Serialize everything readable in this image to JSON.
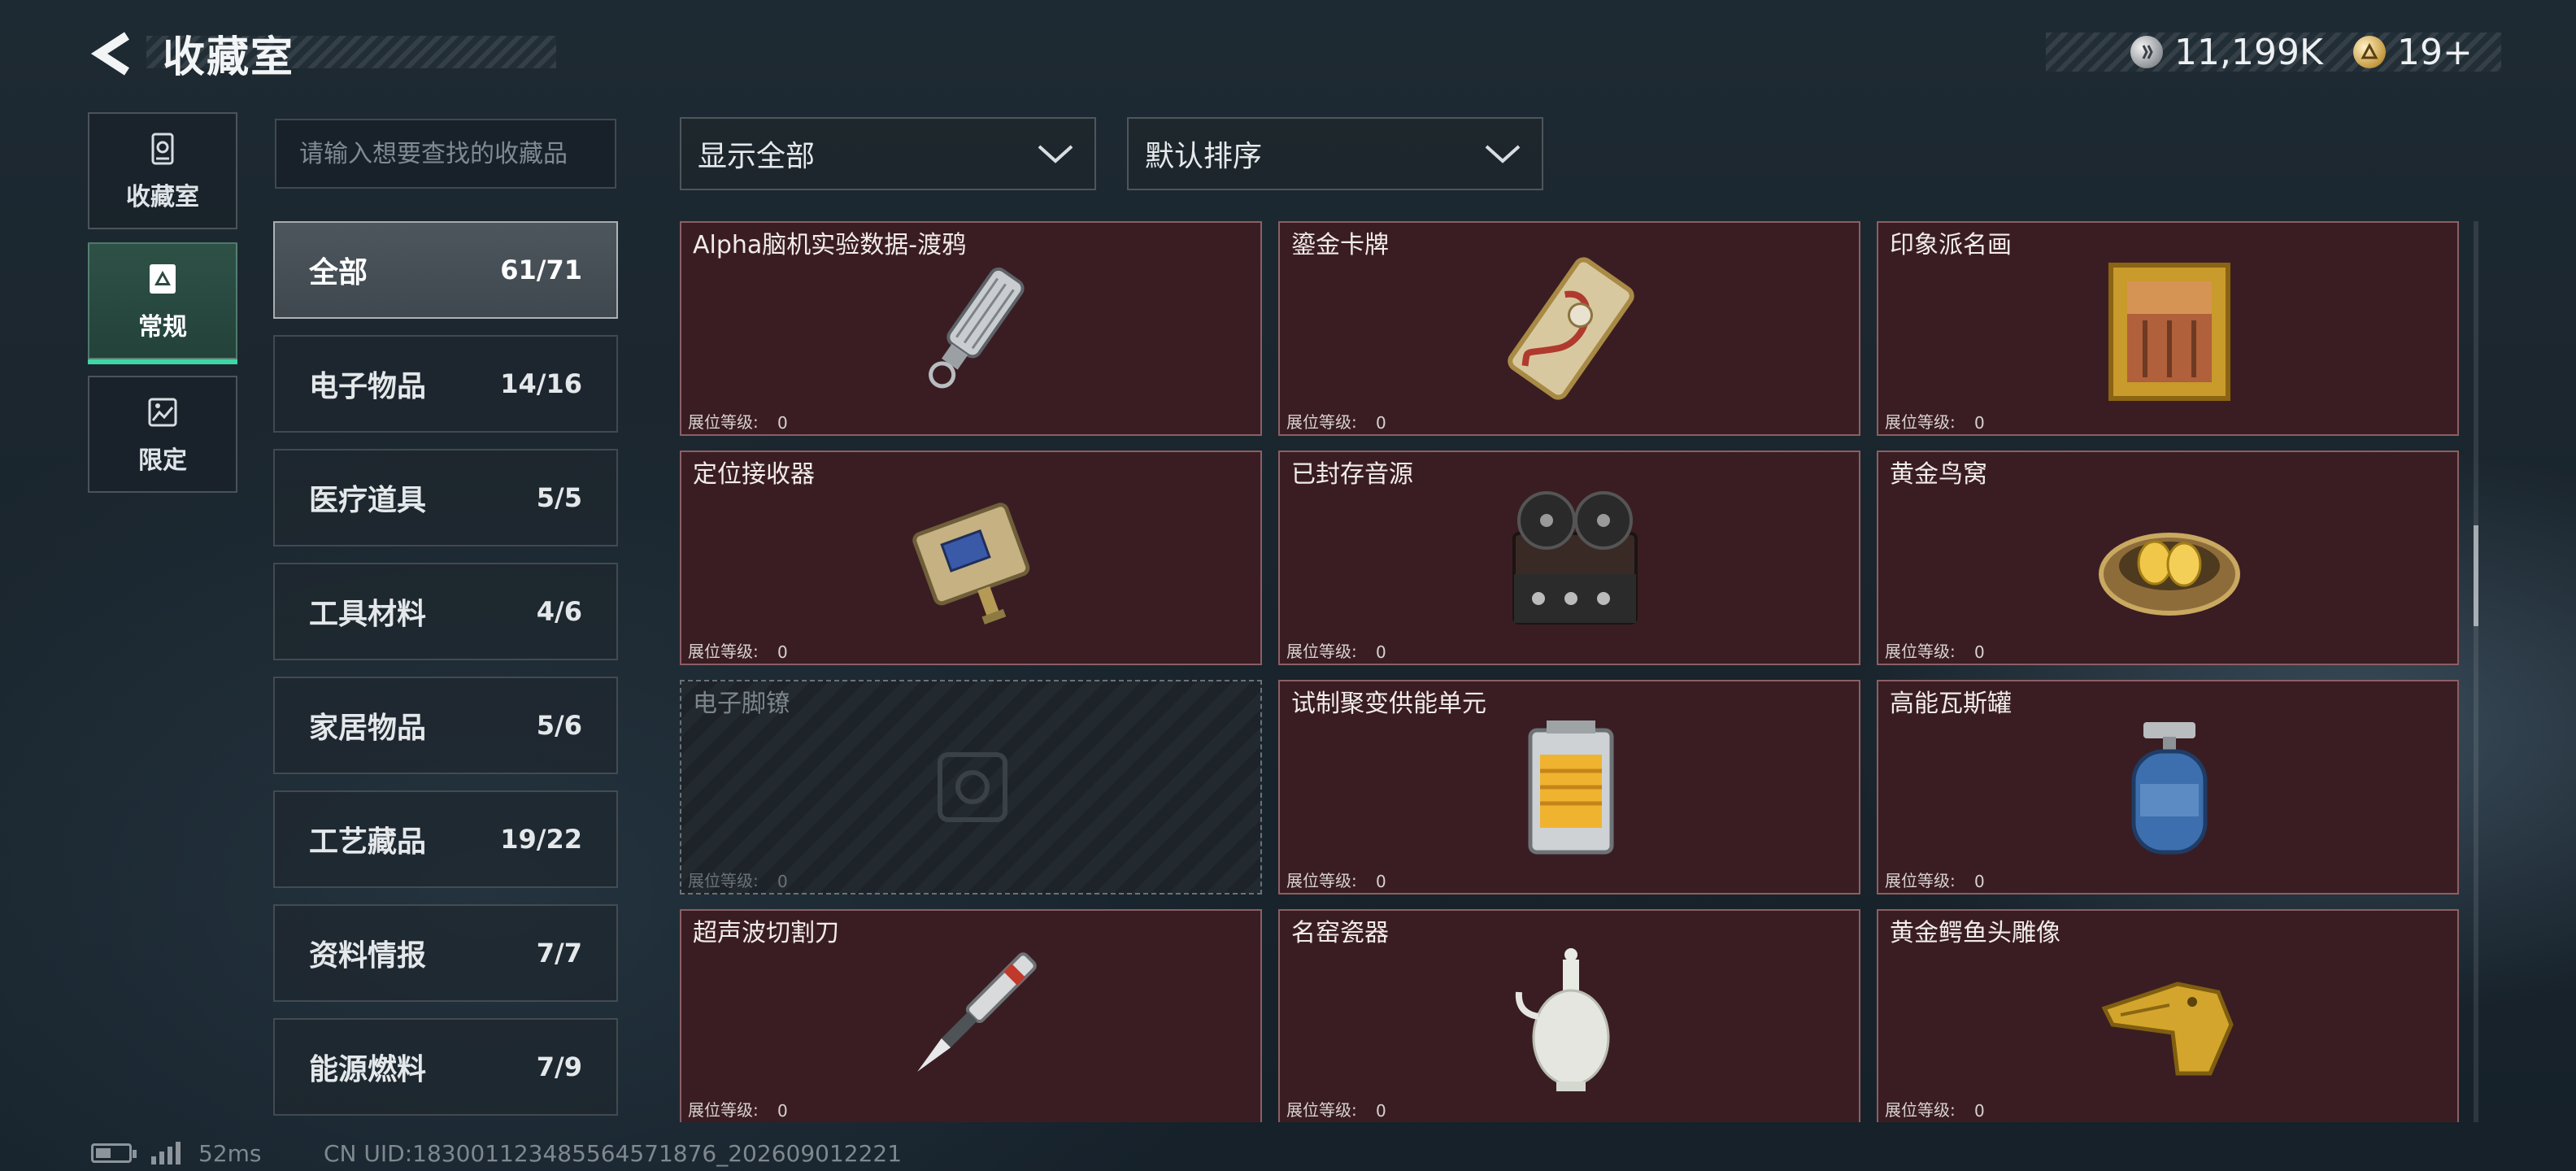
{
  "header": {
    "title": "收藏室",
    "currencies": [
      {
        "icon": "silver-coin-icon",
        "value": "11,199K"
      },
      {
        "icon": "gold-coin-icon",
        "value": "19+"
      }
    ]
  },
  "side_tabs": [
    {
      "label": "收藏室",
      "icon": "collection-room-icon",
      "active": false
    },
    {
      "label": "常规",
      "icon": "regular-icon",
      "active": true
    },
    {
      "label": "限定",
      "icon": "limited-icon",
      "active": false
    }
  ],
  "search": {
    "placeholder": "请输入想要查找的收藏品"
  },
  "categories": [
    {
      "name": "全部",
      "count": "61/71",
      "active": true
    },
    {
      "name": "电子物品",
      "count": "14/16"
    },
    {
      "name": "医疗道具",
      "count": "5/5"
    },
    {
      "name": "工具材料",
      "count": "4/6"
    },
    {
      "name": "家居物品",
      "count": "5/6"
    },
    {
      "name": "工艺藏品",
      "count": "19/22"
    },
    {
      "name": "资料情报",
      "count": "7/7"
    },
    {
      "name": "能源燃料",
      "count": "7/9"
    }
  ],
  "filters": {
    "display": "显示全部",
    "sort": "默认排序"
  },
  "level_label": "展位等级:",
  "items": [
    {
      "name": "Alpha脑机实验数据-渡鸦",
      "level": "0",
      "icon": "usb-drive-icon",
      "locked": false
    },
    {
      "name": "鎏金卡牌",
      "level": "0",
      "icon": "gilded-card-icon",
      "locked": false
    },
    {
      "name": "印象派名画",
      "level": "0",
      "icon": "framed-painting-icon",
      "locked": false
    },
    {
      "name": "定位接收器",
      "level": "0",
      "icon": "gps-receiver-icon",
      "locked": false
    },
    {
      "name": "已封存音源",
      "level": "0",
      "icon": "reel-tape-recorder-icon",
      "locked": false
    },
    {
      "name": "黄金鸟窝",
      "level": "0",
      "icon": "golden-nest-icon",
      "locked": false
    },
    {
      "name": "电子脚镣",
      "level": "0",
      "icon": "ankle-monitor-icon",
      "locked": true
    },
    {
      "name": "试制聚变供能单元",
      "level": "0",
      "icon": "fusion-cell-icon",
      "locked": false
    },
    {
      "name": "高能瓦斯罐",
      "level": "0",
      "icon": "gas-canister-icon",
      "locked": false
    },
    {
      "name": "超声波切割刀",
      "level": "0",
      "icon": "ultrasonic-cutter-icon",
      "locked": false
    },
    {
      "name": "名窑瓷器",
      "level": "0",
      "icon": "porcelain-vase-icon",
      "locked": false
    },
    {
      "name": "黄金鳄鱼头雕像",
      "level": "0",
      "icon": "gold-crocodile-statue-icon",
      "locked": false
    }
  ],
  "footer": {
    "ping": "52ms",
    "uid": "CN UID:183001123485564571876_202609012221"
  }
}
